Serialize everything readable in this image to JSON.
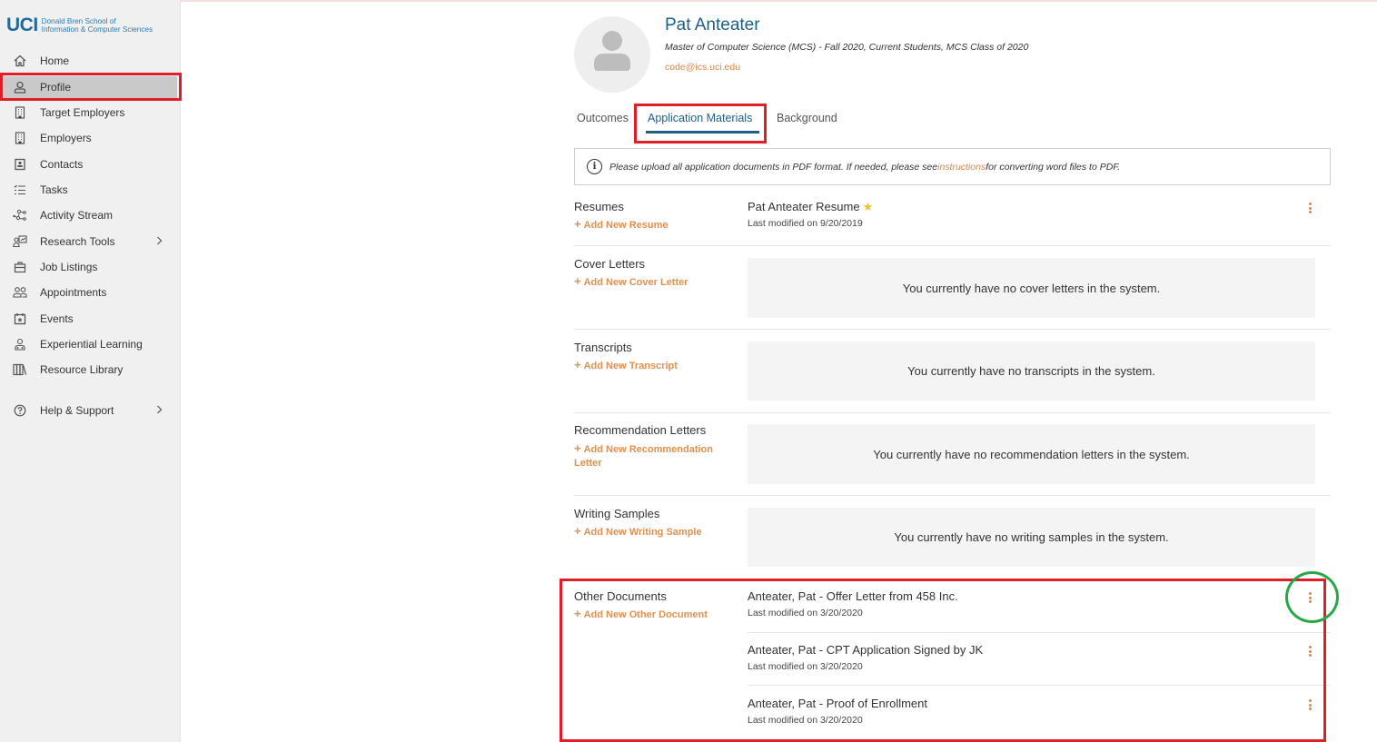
{
  "brand": {
    "short": "UCI",
    "line1": "Donald Bren School of",
    "line2": "Information & Computer Sciences",
    "color": "#1f6b9a"
  },
  "sidebar": {
    "items": [
      {
        "label": "Home",
        "icon": "home-icon"
      },
      {
        "label": "Profile",
        "icon": "user-icon",
        "active": true
      },
      {
        "label": "Target Employers",
        "icon": "building-icon"
      },
      {
        "label": "Employers",
        "icon": "building-icon"
      },
      {
        "label": "Contacts",
        "icon": "contact-card-icon"
      },
      {
        "label": "Tasks",
        "icon": "checklist-icon"
      },
      {
        "label": "Activity Stream",
        "icon": "network-icon"
      },
      {
        "label": "Research Tools",
        "icon": "research-icon",
        "chevron": ">"
      },
      {
        "label": "Job Listings",
        "icon": "briefcase-icon"
      },
      {
        "label": "Appointments",
        "icon": "people-icon"
      },
      {
        "label": "Events",
        "icon": "calendar-star-icon"
      },
      {
        "label": "Experiential Learning",
        "icon": "learner-icon"
      },
      {
        "label": "Resource Library",
        "icon": "books-icon"
      },
      {
        "label": "Help & Support",
        "icon": "help-icon",
        "chevron": ">"
      }
    ]
  },
  "profile": {
    "name": "Pat Anteater",
    "description": "Master of Computer Science (MCS) - Fall 2020, Current Students, MCS Class of 2020",
    "email": "code@ics.uci.edu"
  },
  "tabs": [
    {
      "label": "Outcomes"
    },
    {
      "label": "Application Materials",
      "active": true
    },
    {
      "label": "Background"
    }
  ],
  "notice": {
    "prefix": "Please upload all application documents in PDF format. If needed, please see ",
    "link": "instructions",
    "suffix": " for converting word files to PDF."
  },
  "sections": {
    "resumes": {
      "title": "Resumes",
      "add": "Add New Resume",
      "items": [
        {
          "title": "Pat Anteater Resume",
          "starred": true,
          "modified": "Last modified on 9/20/2019"
        }
      ]
    },
    "cover_letters": {
      "title": "Cover Letters",
      "add": "Add New Cover Letter",
      "empty": "You currently have no cover letters in the system."
    },
    "transcripts": {
      "title": "Transcripts",
      "add": "Add New Transcript",
      "empty": "You currently have no transcripts in the system."
    },
    "recommendation_letters": {
      "title": "Recommendation Letters",
      "add": "Add New Recommendation Letter",
      "empty": "You currently have no recommendation letters in the system."
    },
    "writing_samples": {
      "title": "Writing Samples",
      "add": "Add New Writing Sample",
      "empty": "You currently have no writing samples in the system."
    },
    "other_documents": {
      "title": "Other Documents",
      "add": "Add New Other Document",
      "items": [
        {
          "title": "Anteater, Pat - Offer Letter from 458 Inc.",
          "modified": "Last modified on 3/20/2020"
        },
        {
          "title": "Anteater, Pat - CPT Application Signed by JK",
          "modified": "Last modified on 3/20/2020"
        },
        {
          "title": "Anteater, Pat - Proof of Enrollment",
          "modified": "Last modified on 3/20/2020"
        }
      ]
    }
  },
  "colors": {
    "accent_blue": "#1f5f86",
    "accent_orange": "#e0914f",
    "highlight_red": "#e21d2a",
    "highlight_green": "#27a844"
  }
}
